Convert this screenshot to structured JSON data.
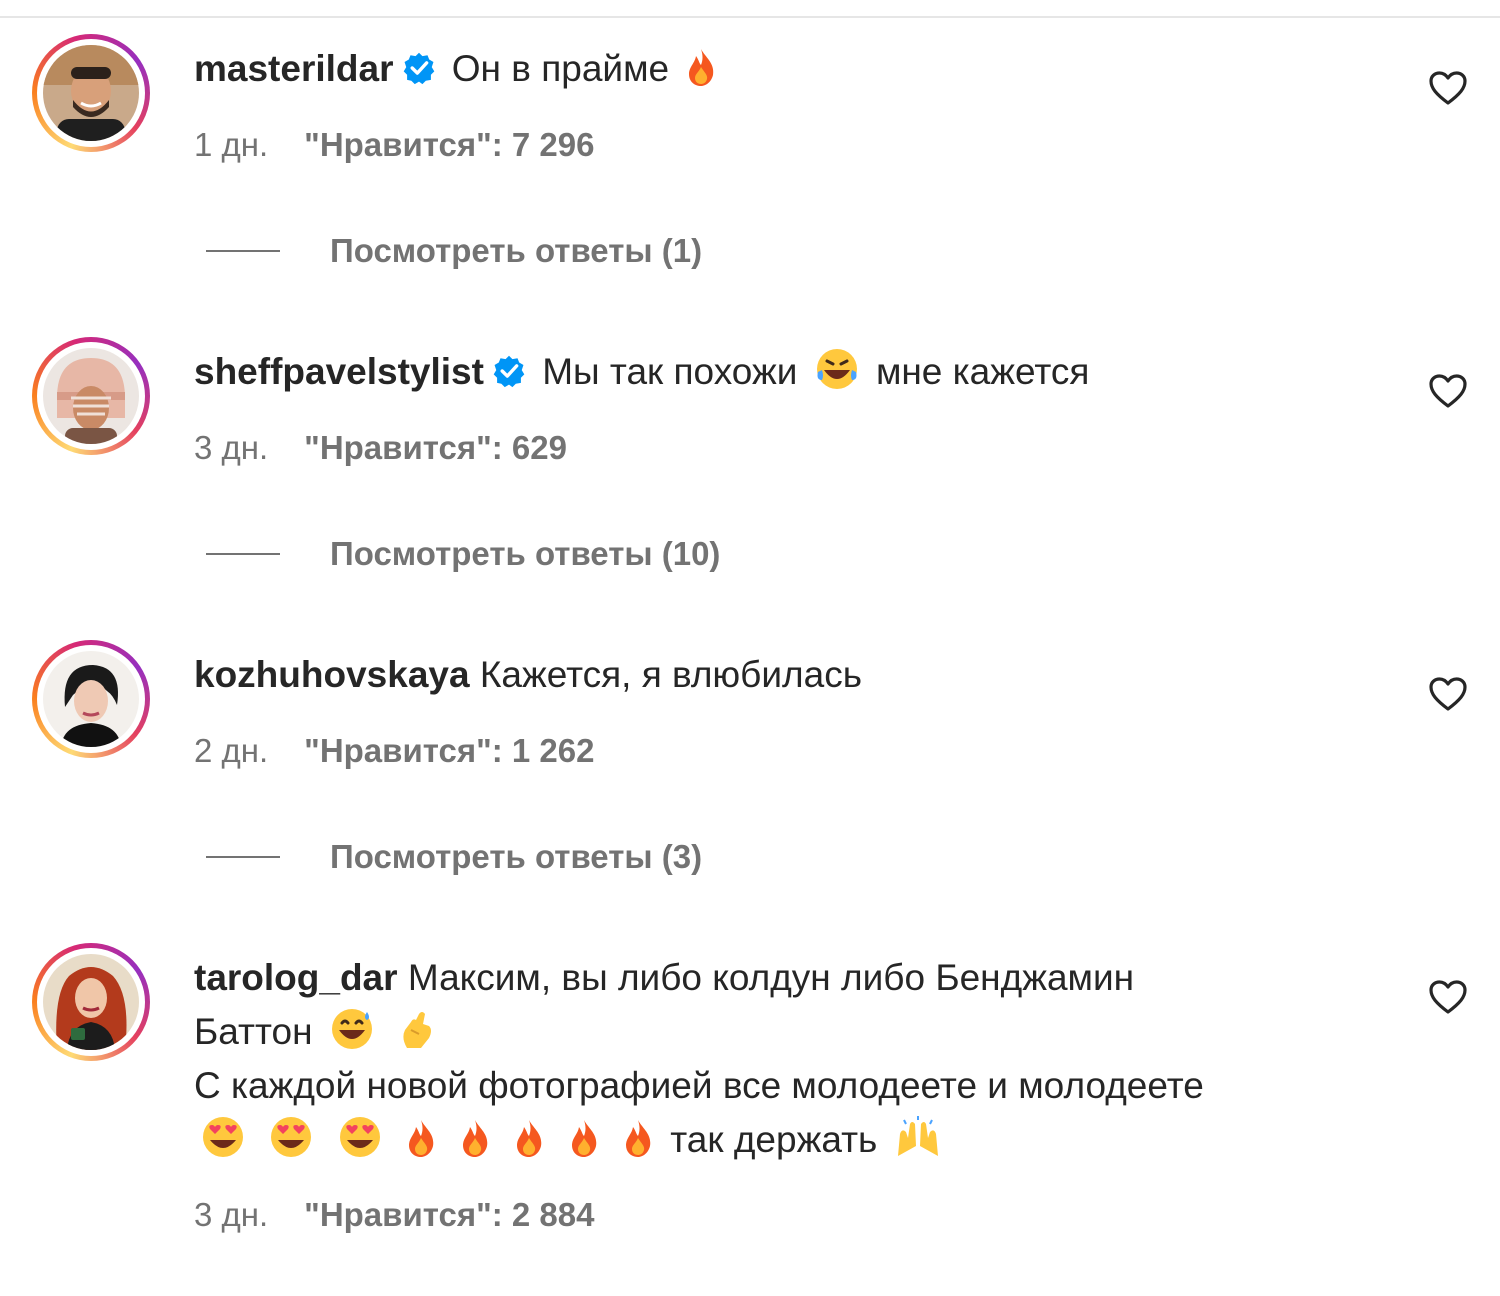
{
  "comments": [
    {
      "username": "masterildar",
      "verified": true,
      "text": "Он в прайме",
      "emoji_after": [
        "fire-emoji"
      ],
      "time": "1 дн.",
      "likes": "\"Нравится\": 7 296",
      "replies": "Посмотреть ответы (1)"
    },
    {
      "username": "sheffpavelstylist",
      "verified": true,
      "text_before": "Мы так похожи",
      "text_after": "мне кажется",
      "emoji_mid": [
        "laughing-tears-emoji"
      ],
      "time": "3 дн.",
      "likes": "\"Нравится\": 629",
      "replies": "Посмотреть ответы (10)"
    },
    {
      "username": "kozhuhovskaya",
      "verified": false,
      "text": "Кажется, я влюбилась",
      "time": "2 дн.",
      "likes": "\"Нравится\": 1 262",
      "replies": "Посмотреть ответы (3)"
    },
    {
      "username": "tarolog_dar",
      "verified": false,
      "line1": "Максим, вы либо колдун либо Бенджамин",
      "line2": "Баттон",
      "line3": "С каждой новой фотографией все молодеете и молодеете",
      "line4": "так держать",
      "time": "3 дн.",
      "likes": "\"Нравится\": 2 884"
    }
  ],
  "colors": {
    "text": "#262626",
    "secondary": "#737373",
    "verified": "#0095f6"
  }
}
